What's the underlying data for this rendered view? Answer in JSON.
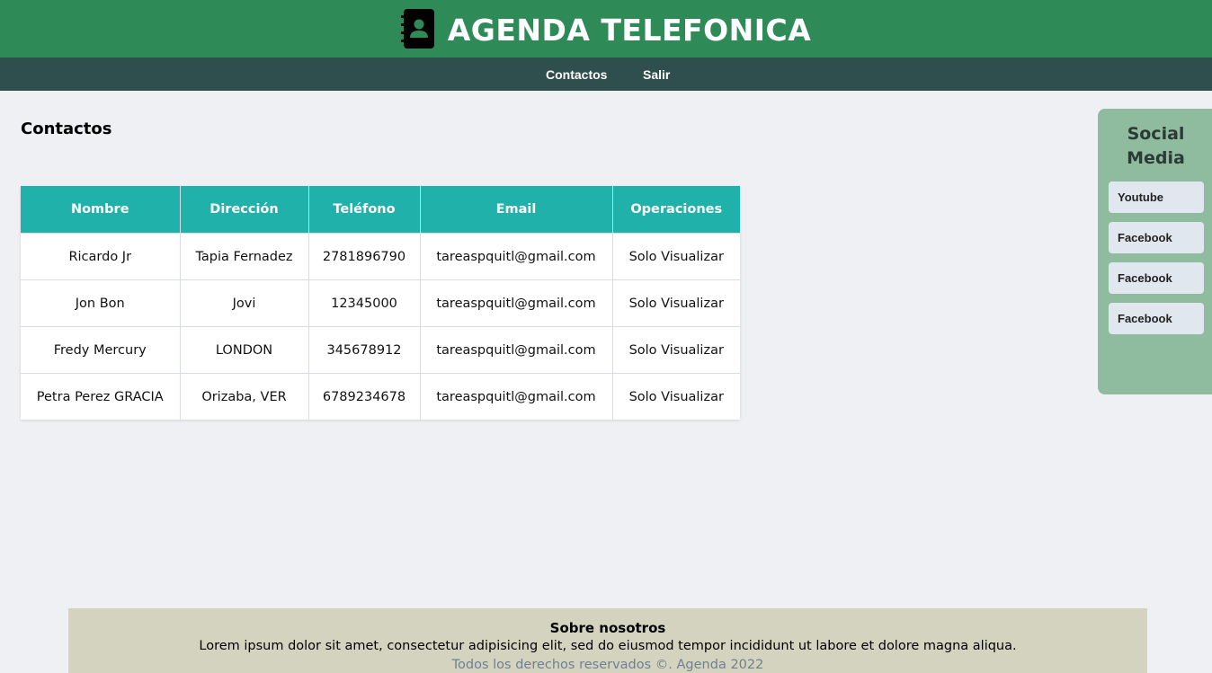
{
  "header": {
    "title": "AGENDA TELEFONICA",
    "logo_icon": "address-book-icon"
  },
  "nav": {
    "items": [
      {
        "label": "Contactos"
      },
      {
        "label": "Salir"
      }
    ]
  },
  "page": {
    "title": "Contactos"
  },
  "table": {
    "columns": [
      "Nombre",
      "Dirección",
      "Teléfono",
      "Email",
      "Operaciones"
    ],
    "rows": [
      {
        "nombre": "Ricardo Jr",
        "direccion": "Tapia Fernadez",
        "telefono": "2781896790",
        "email": "tareaspquitl@gmail.com",
        "operaciones": "Solo Visualizar"
      },
      {
        "nombre": "Jon Bon",
        "direccion": "Jovi",
        "telefono": "12345000",
        "email": "tareaspquitl@gmail.com",
        "operaciones": "Solo Visualizar"
      },
      {
        "nombre": "Fredy Mercury",
        "direccion": "LONDON",
        "telefono": "345678912",
        "email": "tareaspquitl@gmail.com",
        "operaciones": "Solo Visualizar"
      },
      {
        "nombre": "Petra Perez GRACIA",
        "direccion": "Orizaba, VER",
        "telefono": "6789234678",
        "email": "tareaspquitl@gmail.com",
        "operaciones": "Solo Visualizar"
      }
    ]
  },
  "social": {
    "title": "Social Media",
    "links": [
      {
        "label": "Youtube"
      },
      {
        "label": "Facebook"
      },
      {
        "label": "Facebook"
      },
      {
        "label": "Facebook"
      }
    ]
  },
  "footer": {
    "title": "Sobre nosotros",
    "text": "Lorem ipsum dolor sit amet, consectetur adipisicing elit, sed do eiusmod tempor incididunt ut labore et dolore magna aliqua.",
    "copyright": "Todos los derechos reservados ©. Agenda 2022"
  },
  "colors": {
    "header_bg": "#2e8b57",
    "nav_bg": "#2f4f4f",
    "table_header_bg": "#20b2aa",
    "social_bg": "#8fbc9f",
    "footer_bg": "#d3d3bf",
    "page_bg": "#eff0f4"
  }
}
